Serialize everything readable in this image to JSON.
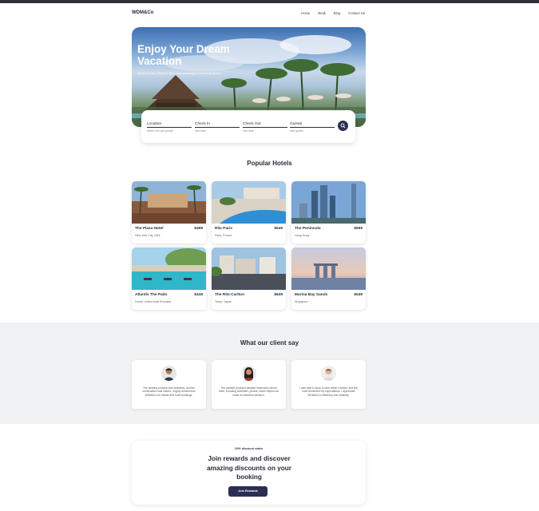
{
  "nav": {
    "logo": "WDM&Co",
    "links": [
      "Home",
      "Book",
      "Blog",
      "Contact Us"
    ]
  },
  "hero": {
    "title": "Enjoy Your Dream Vacation",
    "subtitle": "Book Hotels, Flights and stay packages at lowest price."
  },
  "search": {
    "fields": [
      {
        "label": "Location",
        "placeholder": "Where are you going?"
      },
      {
        "label": "Check In",
        "placeholder": "Add date"
      },
      {
        "label": "Check Out",
        "placeholder": "Add date"
      },
      {
        "label": "Guests",
        "placeholder": "Add guests"
      }
    ]
  },
  "popular": {
    "title": "Popular Hotels",
    "hotels": [
      {
        "name": "The Plaza Hotel",
        "price": "$499",
        "location": "New York City, USA"
      },
      {
        "name": "Ritz Paris",
        "price": "$549",
        "location": "Paris, France"
      },
      {
        "name": "The Peninsula",
        "price": "$599",
        "location": "Hong Kong"
      },
      {
        "name": "Atlantis The Palm",
        "price": "$449",
        "location": "Dubai, United Arab Emirates"
      },
      {
        "name": "The Ritz-Carlton",
        "price": "$649",
        "location": "Tokyo, Japan"
      },
      {
        "name": "Marina Bay Sands",
        "price": "$549",
        "location": "Singapore"
      }
    ]
  },
  "testimonials": {
    "title": "What our client say",
    "items": [
      {
        "quote": "The booking process was seamless, and the confirmation was instant. I highly recommend WDM&Co for hassle-free hotel bookings."
      },
      {
        "quote": "The website provided detailed information about hotel, including amenities, photos, which helped me make an informed decision."
      },
      {
        "quote": "I was able to book a room within minutes, and the hotel exceeded my expectations. I appreciate WDM&Co's efficiency and reliability."
      }
    ]
  },
  "rewards": {
    "small": "100+ discount codes",
    "headline": "Join rewards and discover amazing discounts on your booking",
    "button": "Join Rewards"
  },
  "colors": {
    "accent": "#2c2f54",
    "section_bg": "#f1f2f4"
  },
  "icons": {
    "search_button": "search-icon"
  }
}
